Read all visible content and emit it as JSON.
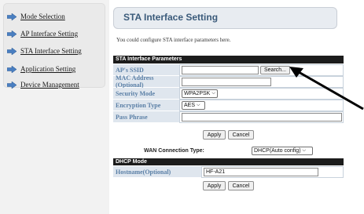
{
  "sidebar": {
    "items": [
      {
        "label": "Mode Selection"
      },
      {
        "label": "AP Interface Setting"
      },
      {
        "label": "STA Interface Setting"
      },
      {
        "label": "Application Setting"
      },
      {
        "label": "Device Management"
      }
    ]
  },
  "header": {
    "title": "STA Interface Setting"
  },
  "description": "You could configure STA interface parameters here.",
  "sta_params": {
    "header": "STA Interface Parameters",
    "ssid_label": "AP's SSID",
    "ssid_value": "",
    "search_label": "Search...",
    "mac_label": "MAC Address (Optional)",
    "mac_value": "",
    "security_label": "Security Mode",
    "security_value": "WPA2PSK",
    "encryption_label": "Encryption Type",
    "encryption_value": "AES",
    "passphrase_label": "Pass Phrase",
    "passphrase_value": ""
  },
  "buttons": {
    "apply": "Apply",
    "cancel": "Cancel"
  },
  "wan": {
    "label": "WAN Connection Type:",
    "value": "DHCP(Auto config)"
  },
  "dhcp": {
    "header": "DHCP Mode",
    "hostname_label": "Hostname(Optional)",
    "hostname_value": "HF-A21"
  },
  "colors": {
    "accent": "#3a5a7a",
    "row_label": "#dfe6ee",
    "header_bar": "#1c1c1c",
    "arrow_blue": "#4a7fc1"
  },
  "icons": {
    "nav_arrow": "arrow-right-icon"
  }
}
